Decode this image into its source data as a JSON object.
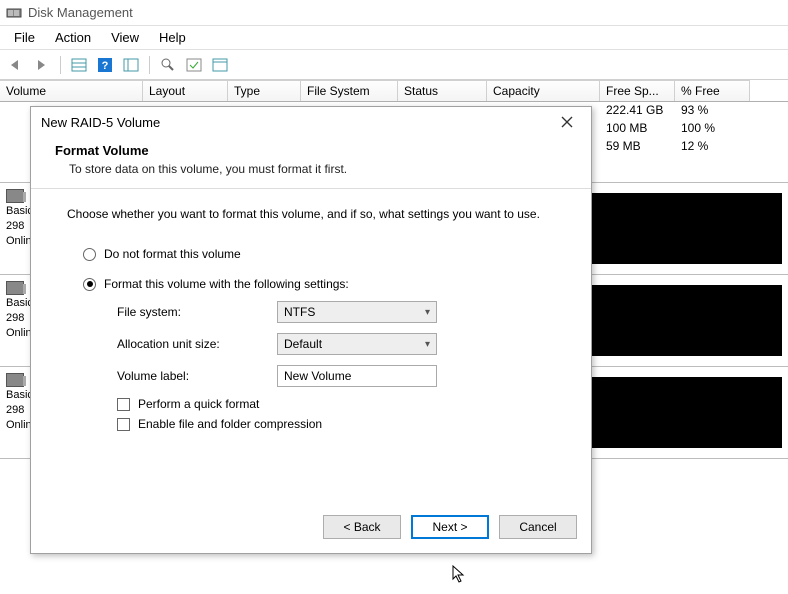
{
  "window_title": "Disk Management",
  "menu": {
    "file": "File",
    "action": "Action",
    "view": "View",
    "help": "Help"
  },
  "columns": {
    "volume": "Volume",
    "layout": "Layout",
    "type": "Type",
    "file_system": "File System",
    "status": "Status",
    "capacity": "Capacity",
    "free_space": "Free Sp...",
    "pct_free": "% Free"
  },
  "col_widths": {
    "volume": 143,
    "layout": 85,
    "type": 73,
    "file_system": 97,
    "status": 89,
    "capacity": 113,
    "free_space": 75,
    "pct_free": 75
  },
  "rows": [
    {
      "free_space": "222.41 GB",
      "pct_free": "93 %"
    },
    {
      "free_space": "100 MB",
      "pct_free": "100 %"
    },
    {
      "free_space": "59 MB",
      "pct_free": "12 %"
    }
  ],
  "disk_labels": [
    {
      "line1": "Basic",
      "line2": "298",
      "line3": "Online"
    },
    {
      "line1": "Basic",
      "line2": "298",
      "line3": "Online"
    },
    {
      "line1": "Basic",
      "line2": "298",
      "line3": "Online"
    }
  ],
  "dialog": {
    "title": "New RAID-5 Volume",
    "heading": "Format Volume",
    "subheading": "To store data on this volume, you must format it first.",
    "instruction": "Choose whether you want to format this volume, and if so, what settings you want to use.",
    "radio_noformat": "Do not format this volume",
    "radio_format": "Format this volume with the following settings:",
    "lbl_fs": "File system:",
    "lbl_aus": "Allocation unit size:",
    "lbl_vollabel": "Volume label:",
    "val_fs": "NTFS",
    "val_aus": "Default",
    "val_vollabel": "New Volume",
    "chk_quick": "Perform a quick format",
    "chk_compress": "Enable file and folder compression",
    "btn_back": "< Back",
    "btn_next": "Next >",
    "btn_cancel": "Cancel"
  }
}
